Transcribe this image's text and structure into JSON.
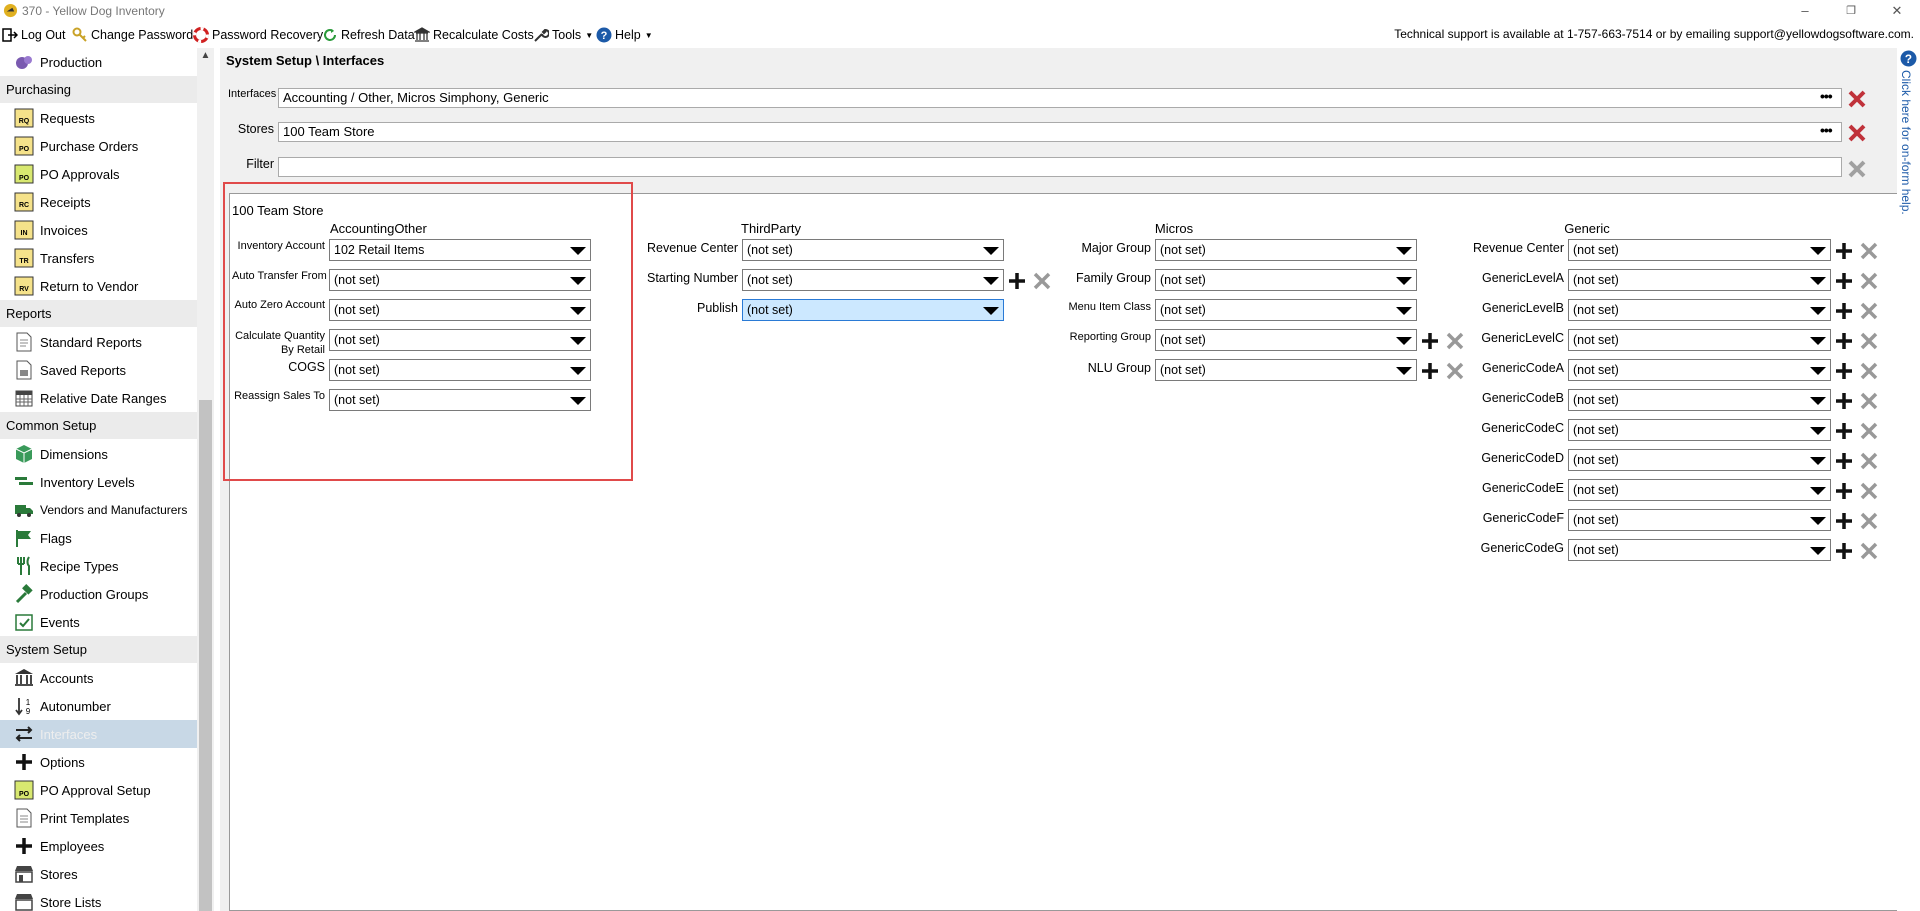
{
  "window": {
    "title": "370 - Yellow Dog Inventory",
    "controls": [
      "–",
      "❐",
      "✕"
    ]
  },
  "toolbar": {
    "items": [
      {
        "label": "Log Out",
        "icon": "logout-icon"
      },
      {
        "label": "Change Password",
        "icon": "key-icon"
      },
      {
        "label": "Password Recovery",
        "icon": "lifebuoy-icon"
      },
      {
        "label": "Refresh Data",
        "icon": "refresh-icon"
      },
      {
        "label": "Recalculate Costs",
        "icon": "bank-icon"
      },
      {
        "label": "Tools",
        "icon": "wrench-icon"
      },
      {
        "label": "Help",
        "icon": "help-icon"
      }
    ],
    "support": "Technical support is available at 1-757-663-7514 or by emailing support@yellowdogsoftware.com."
  },
  "sidebar": {
    "top_item": "Production",
    "sections": [
      {
        "title": "Purchasing",
        "items": [
          "Requests",
          "Purchase Orders",
          "PO Approvals",
          "Receipts",
          "Invoices",
          "Transfers",
          "Return to Vendor"
        ]
      },
      {
        "title": "Reports",
        "items": [
          "Standard Reports",
          "Saved Reports",
          "Relative Date Ranges"
        ]
      },
      {
        "title": "Common Setup",
        "items": [
          "Dimensions",
          "Inventory Levels",
          "Vendors and Manufacturers",
          "Flags",
          "Recipe Types",
          "Production Groups",
          "Events"
        ]
      },
      {
        "title": "System Setup",
        "items": [
          "Accounts",
          "Autonumber",
          "Interfaces",
          "Options",
          "PO Approval Setup",
          "Print Templates",
          "Employees",
          "Stores",
          "Store Lists"
        ]
      }
    ],
    "selected": "Interfaces"
  },
  "main": {
    "breadcrumb": "System Setup \\ Interfaces",
    "interfaces_label": "Interfaces",
    "interfaces_value": "Accounting / Other, Micros Simphony, Generic",
    "stores_label": "Stores",
    "stores_value": "100 Team Store",
    "filter_label": "Filter",
    "filter_value": "",
    "dots": "•••"
  },
  "panel": {
    "store_title": "100 Team Store",
    "accounting": {
      "heading": "AccountingOther",
      "rows": [
        {
          "label": "Inventory Account",
          "value": "102 Retail Items"
        },
        {
          "label": "Auto Transfer From",
          "value": "(not set)"
        },
        {
          "label": "Auto Zero Account",
          "value": "(not set)"
        },
        {
          "label": "Calculate Quantity",
          "label2": "By Retail",
          "value": "(not set)"
        },
        {
          "label": "COGS",
          "value": "(not set)"
        },
        {
          "label": "Reassign Sales To",
          "value": "(not set)"
        }
      ]
    },
    "thirdparty": {
      "heading": "ThirdParty",
      "rows": [
        {
          "label": "Revenue Center",
          "value": "(not set)"
        },
        {
          "label": "Starting Number",
          "value": "(not set)"
        },
        {
          "label": "Publish",
          "value": "(not set)"
        }
      ]
    },
    "micros": {
      "heading": "Micros",
      "rows": [
        {
          "label": "Major Group",
          "value": "(not set)"
        },
        {
          "label": "Family Group",
          "value": "(not set)"
        },
        {
          "label": "Menu Item Class",
          "value": "(not set)"
        },
        {
          "label": "Reporting Group",
          "value": "(not set)"
        },
        {
          "label": "NLU Group",
          "value": "(not set)"
        }
      ]
    },
    "generic": {
      "heading": "Generic",
      "rows": [
        {
          "label": "Revenue Center",
          "value": "(not set)"
        },
        {
          "label": "GenericLevelA",
          "value": "(not set)"
        },
        {
          "label": "GenericLevelB",
          "value": "(not set)"
        },
        {
          "label": "GenericLevelC",
          "value": "(not set)"
        },
        {
          "label": "GenericCodeA",
          "value": "(not set)"
        },
        {
          "label": "GenericCodeB",
          "value": "(not set)"
        },
        {
          "label": "GenericCodeC",
          "value": "(not set)"
        },
        {
          "label": "GenericCodeD",
          "value": "(not set)"
        },
        {
          "label": "GenericCodeE",
          "value": "(not set)"
        },
        {
          "label": "GenericCodeF",
          "value": "(not set)"
        },
        {
          "label": "GenericCodeG",
          "value": "(not set)"
        }
      ]
    }
  },
  "side_help": "Click here for on-form help.",
  "colors": {
    "accent": "#1c5aa8",
    "red": "#c0323a",
    "highlight": "#cce8ff",
    "selected": "#c8d8e6"
  }
}
